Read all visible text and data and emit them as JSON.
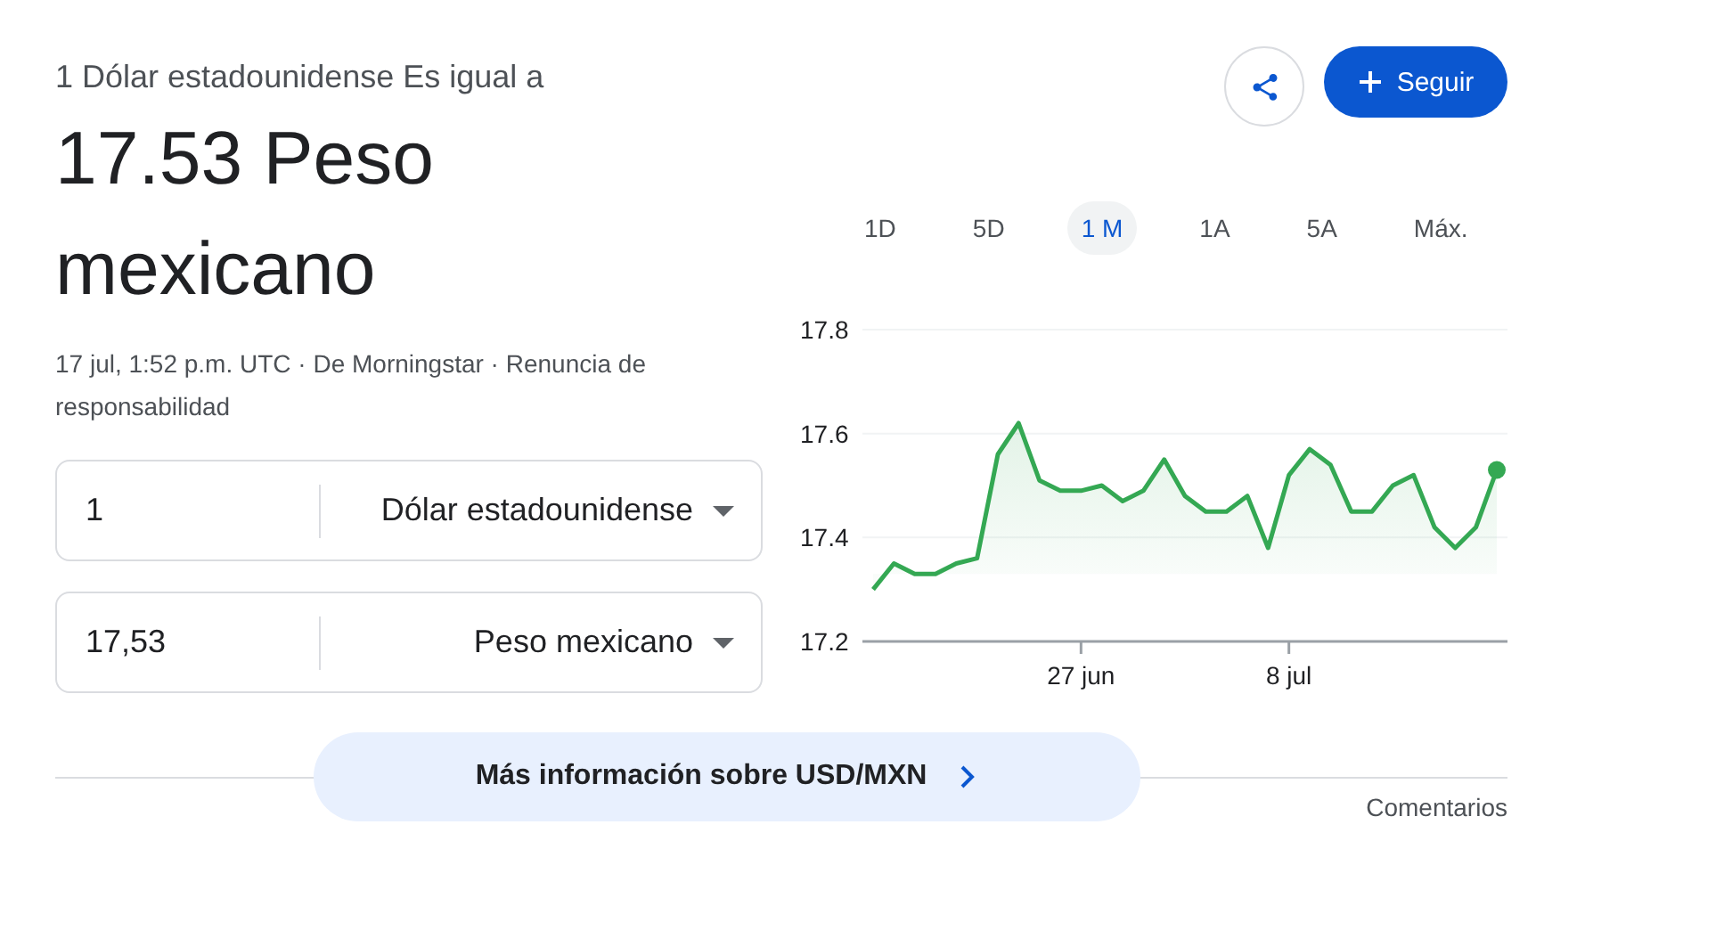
{
  "header": {
    "subtitle": "1 Dólar estadounidense Es igual a",
    "result": "17.53 Peso mexicano",
    "meta": "17 jul, 1:52 p.m. UTC · De Morningstar · Renuncia de responsabilidad"
  },
  "converters": [
    {
      "amount": "1",
      "currency": "Dólar estadounidense"
    },
    {
      "amount": "17,53",
      "currency": "Peso mexicano"
    }
  ],
  "follow_button": "Seguir",
  "ranges": [
    {
      "label": "1D",
      "selected": false
    },
    {
      "label": "5D",
      "selected": false
    },
    {
      "label": "1 M",
      "selected": true
    },
    {
      "label": "1A",
      "selected": false
    },
    {
      "label": "5A",
      "selected": false
    },
    {
      "label": "Máx.",
      "selected": false
    }
  ],
  "chart_data": {
    "type": "line",
    "categories": [
      null,
      null,
      null,
      null,
      null,
      null,
      null,
      null,
      null,
      null,
      "27 jun",
      null,
      null,
      null,
      null,
      null,
      null,
      null,
      null,
      null,
      "8 jul",
      null,
      null,
      null,
      null,
      null,
      null,
      null,
      null,
      null,
      null
    ],
    "ylim": [
      17.2,
      17.8
    ],
    "yticks": [
      17.2,
      17.4,
      17.6,
      17.8
    ],
    "series": [
      {
        "color": "#34a853",
        "values": [
          17.3,
          17.35,
          17.33,
          17.33,
          17.35,
          17.36,
          17.56,
          17.62,
          17.51,
          17.49,
          17.49,
          17.5,
          17.47,
          17.49,
          17.55,
          17.48,
          17.45,
          17.45,
          17.48,
          17.38,
          17.52,
          17.57,
          17.54,
          17.45,
          17.45,
          17.5,
          17.52,
          17.42,
          17.38,
          17.42,
          17.53
        ]
      }
    ]
  },
  "more_info": "Más información sobre USD/MXN",
  "feedback": "Comentarios"
}
